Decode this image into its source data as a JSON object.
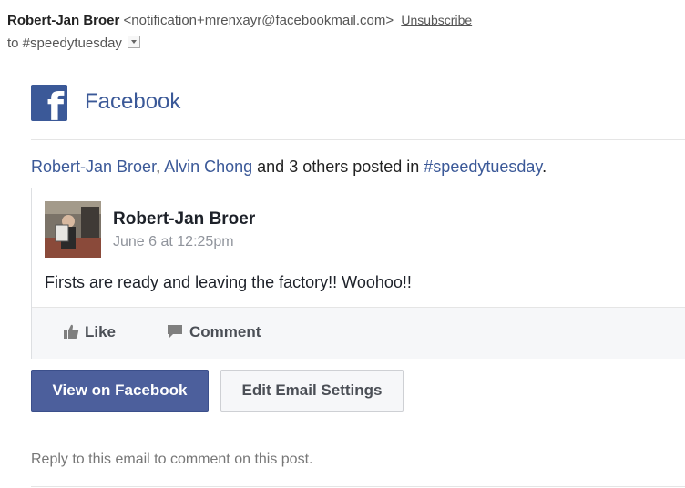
{
  "email_header": {
    "sender_name": "Robert-Jan Broer",
    "sender_email": "<notification+mrenxayr@facebookmail.com>",
    "unsubscribe": "Unsubscribe",
    "to_line": "to #speedytuesday"
  },
  "brand": {
    "name": "Facebook",
    "logo_letter": "f",
    "logo_color": "#3b5998"
  },
  "summary": {
    "user1": "Robert-Jan Broer",
    "sep": ", ",
    "user2": "Alvin Chong",
    "middle": " and 3 others posted in ",
    "group": "#speedytuesday",
    "end": "."
  },
  "post": {
    "author": "Robert-Jan Broer",
    "date": "June 6 at 12:25pm",
    "text": "Firsts are ready and leaving the factory!! Woohoo!!",
    "actions": {
      "like": "Like",
      "comment": "Comment"
    }
  },
  "buttons": {
    "view": "View on Facebook",
    "settings": "Edit Email Settings"
  },
  "footer": {
    "reply_hint": "Reply to this email to comment on this post."
  }
}
